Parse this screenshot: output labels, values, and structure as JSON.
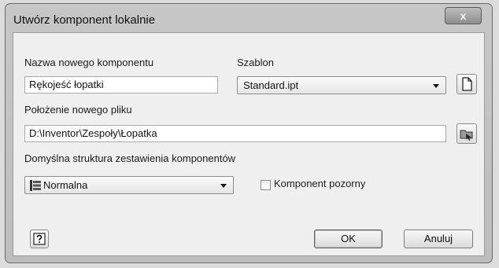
{
  "window": {
    "title": "Utwórz komponent lokalnie",
    "close_glyph": "x"
  },
  "form": {
    "name_label": "Nazwa nowego komponentu",
    "name_value": "Rękojeść łopatki",
    "template_label": "Szablon",
    "template_value": "Standard.ipt",
    "template_browse_icon": "new-file-icon",
    "location_label": "Położenie nowego pliku",
    "location_value": "D:\\Inventor\\Zespoły\\Łopatka",
    "location_browse_icon": "folder-browse-icon",
    "bom_label": "Domyślna struktura zestawienia komponentów",
    "bom_value": "Normalna",
    "bom_icon": "bom-structure-icon",
    "virtual_label": "Komponent pozorny",
    "virtual_checked": false
  },
  "buttons": {
    "help_icon": "help-icon",
    "ok": "OK",
    "cancel": "Anuluj"
  }
}
